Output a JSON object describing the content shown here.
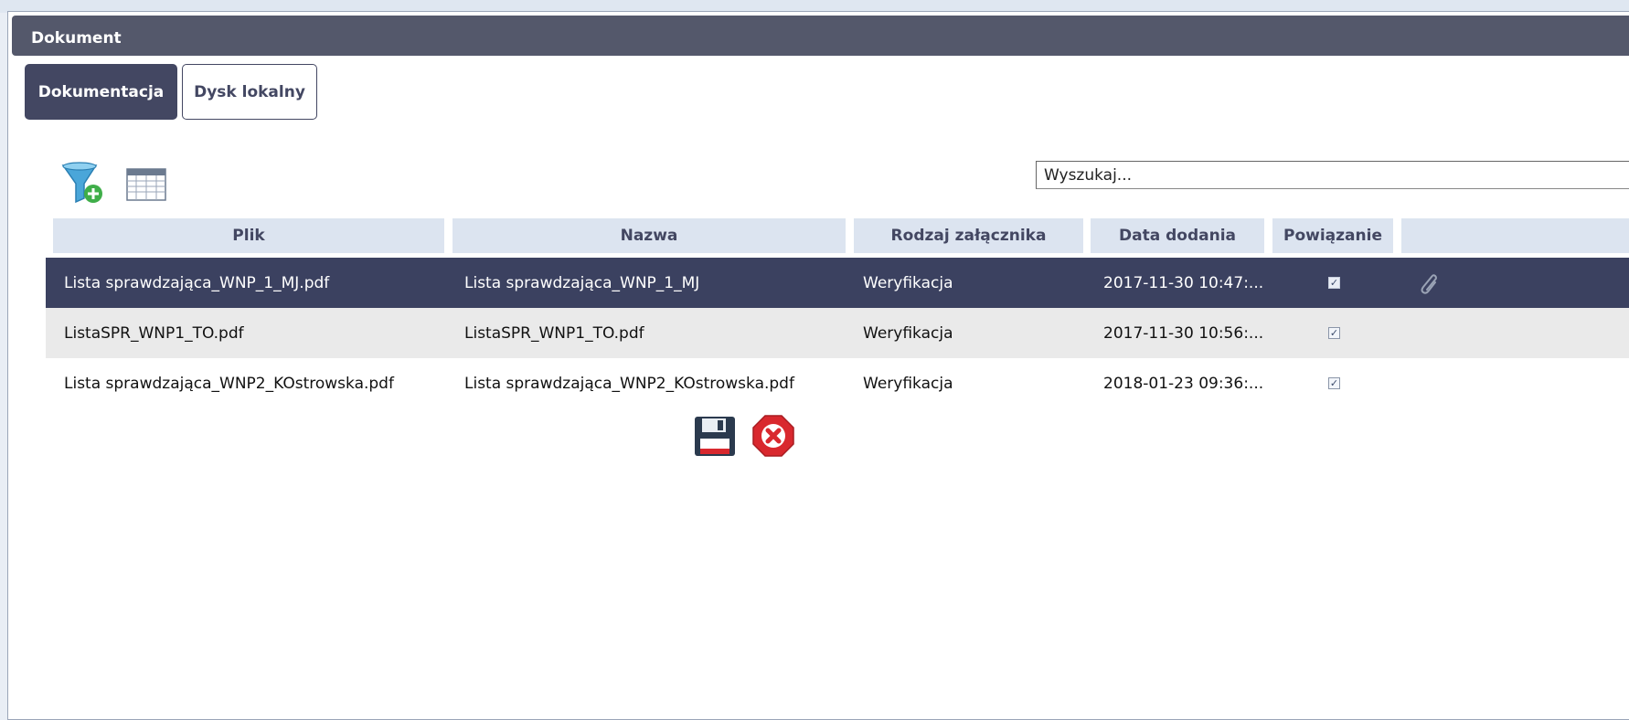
{
  "dialog": {
    "title": "Dokument"
  },
  "tabs": [
    {
      "label": "Dokumentacja",
      "active": true
    },
    {
      "label": "Dysk lokalny",
      "active": false
    }
  ],
  "toolbar": {
    "icons": [
      "filter-add-icon",
      "table-columns-icon"
    ]
  },
  "search": {
    "placeholder": "Wyszukaj..."
  },
  "table": {
    "columns": [
      "Plik",
      "Nazwa",
      "Rodzaj załącznika",
      "Data dodania",
      "Powiązanie"
    ],
    "rows": [
      {
        "plik": "Lista sprawdzająca_WNP_1_MJ.pdf",
        "nazwa": "Lista sprawdzająca_WNP_1_MJ",
        "rodzaj": "Weryfikacja",
        "data": "2017-11-30 10:47:...",
        "powiazanie": true,
        "selected": true
      },
      {
        "plik": "ListaSPR_WNP1_TO.pdf",
        "nazwa": "ListaSPR_WNP1_TO.pdf",
        "rodzaj": "Weryfikacja",
        "data": "2017-11-30 10:56:...",
        "powiazanie": true,
        "selected": false
      },
      {
        "plik": "Lista sprawdzająca_WNP2_KOstrowska.pdf",
        "nazwa": "Lista sprawdzająca_WNP2_KOstrowska.pdf",
        "rodzaj": "Weryfikacja",
        "data": "2018-01-23 09:36:...",
        "powiazanie": true,
        "selected": false
      }
    ]
  },
  "actions": {
    "icons": [
      "save-icon",
      "close-icon"
    ]
  },
  "colors": {
    "title_bar": "#54586b",
    "selected_row": "#3b4160",
    "header_bg": "#dce4f0",
    "close_red": "#d9282e"
  }
}
